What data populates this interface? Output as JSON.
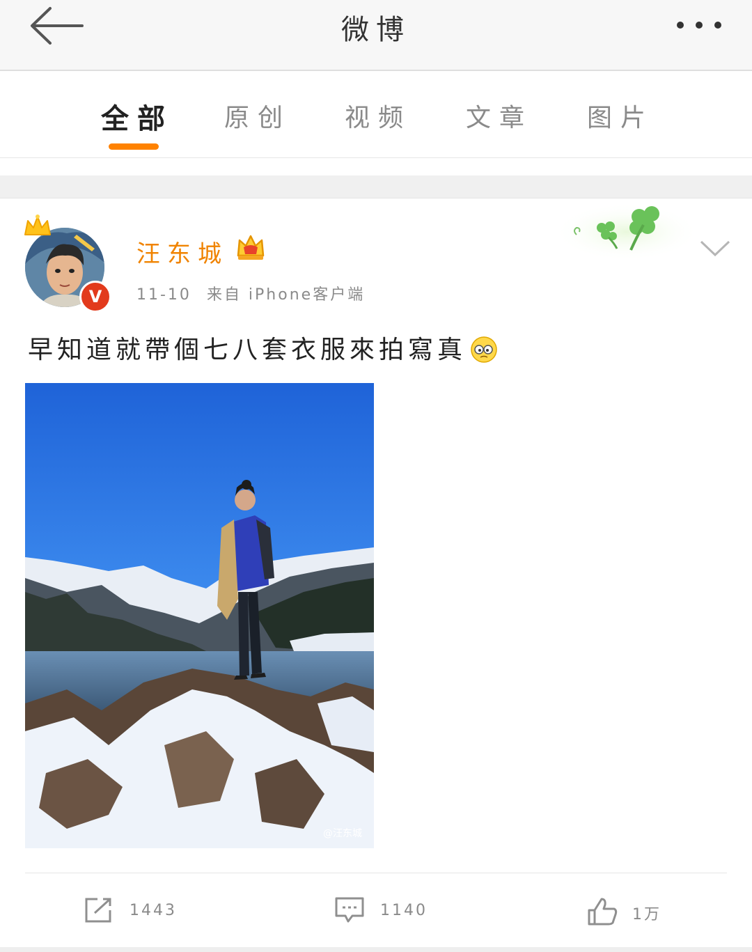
{
  "titlebar": {
    "title": "微博",
    "back_icon": "arrow-left-icon",
    "more_icon": "more-dots-icon"
  },
  "tabs": [
    {
      "label": "全部",
      "active": true
    },
    {
      "label": "原创",
      "active": false
    },
    {
      "label": "视频",
      "active": false
    },
    {
      "label": "文章",
      "active": false
    },
    {
      "label": "图片",
      "active": false
    }
  ],
  "post": {
    "author": "汪东城",
    "verified_badge": "V",
    "date": "11-10",
    "source": "来自 iPhone客户端",
    "text": "早知道就帶個七八套衣服來拍寫真",
    "emoji": "sweat-face-emoji",
    "photo_watermark": "@汪东城",
    "actions": {
      "repost": "1443",
      "comment": "1140",
      "like": "1万"
    }
  },
  "colors": {
    "accent": "#ff8200",
    "author_name": "#f08300",
    "verified": "#e23a1c"
  }
}
